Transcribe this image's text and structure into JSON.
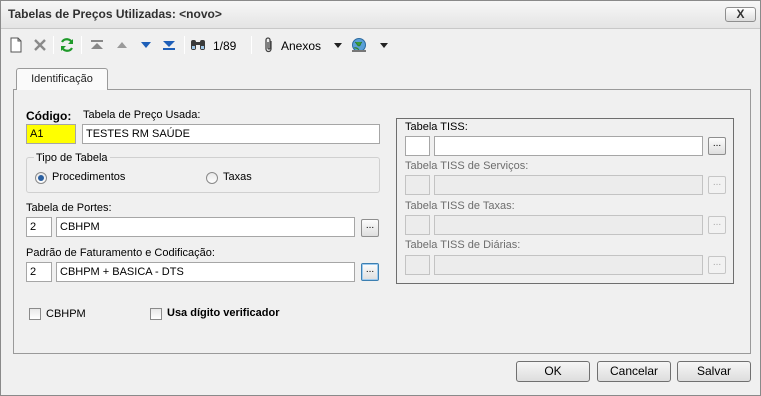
{
  "window": {
    "title": "Tabelas de Preços Utilizadas: <novo>",
    "close_label": "X"
  },
  "toolbar": {
    "record_position": "1/89",
    "anexos_label": "Anexos",
    "icons": [
      "new-document-icon",
      "delete-icon",
      "refresh-icon",
      "first-record-icon",
      "previous-record-icon",
      "next-record-icon",
      "last-record-icon",
      "binoculars-icon",
      "paperclip-icon",
      "globe-icon"
    ]
  },
  "tabs": [
    {
      "label": "Identificação",
      "active": true
    }
  ],
  "form": {
    "codigo_label": "Código:",
    "codigo_value": "A1",
    "tabela_usada_label": "Tabela de Preço Usada:",
    "tabela_usada_value": "TESTES RM SAÚDE",
    "tipo_tabela_label": "Tipo de Tabela",
    "tipo_options": [
      {
        "label": "Procedimentos",
        "checked": true
      },
      {
        "label": "Taxas",
        "checked": false
      }
    ],
    "portes_label": "Tabela de Portes:",
    "portes_code": "2",
    "portes_value": "CBHPM",
    "padrao_label": "Padrão de Faturamento e Codificação:",
    "padrao_code": "2",
    "padrao_value": "CBHPM + BASICA - DTS",
    "lookup_label": "...",
    "cbhpm_check_label": "CBHPM",
    "digito_check_label": "Usa dígito verificador"
  },
  "tiss": {
    "tabela_tiss_label": "Tabela TISS:",
    "servicos_label": "Tabela TISS de Serviços:",
    "taxas_label": "Tabela TISS de Taxas:",
    "diarias_label": "Tabela TISS de Diárias:"
  },
  "buttons": {
    "ok": "OK",
    "cancel": "Cancelar",
    "save": "Salvar"
  },
  "colors": {
    "codigo_highlight": "#ffff00",
    "radio_selected": "#2a5fa0"
  }
}
